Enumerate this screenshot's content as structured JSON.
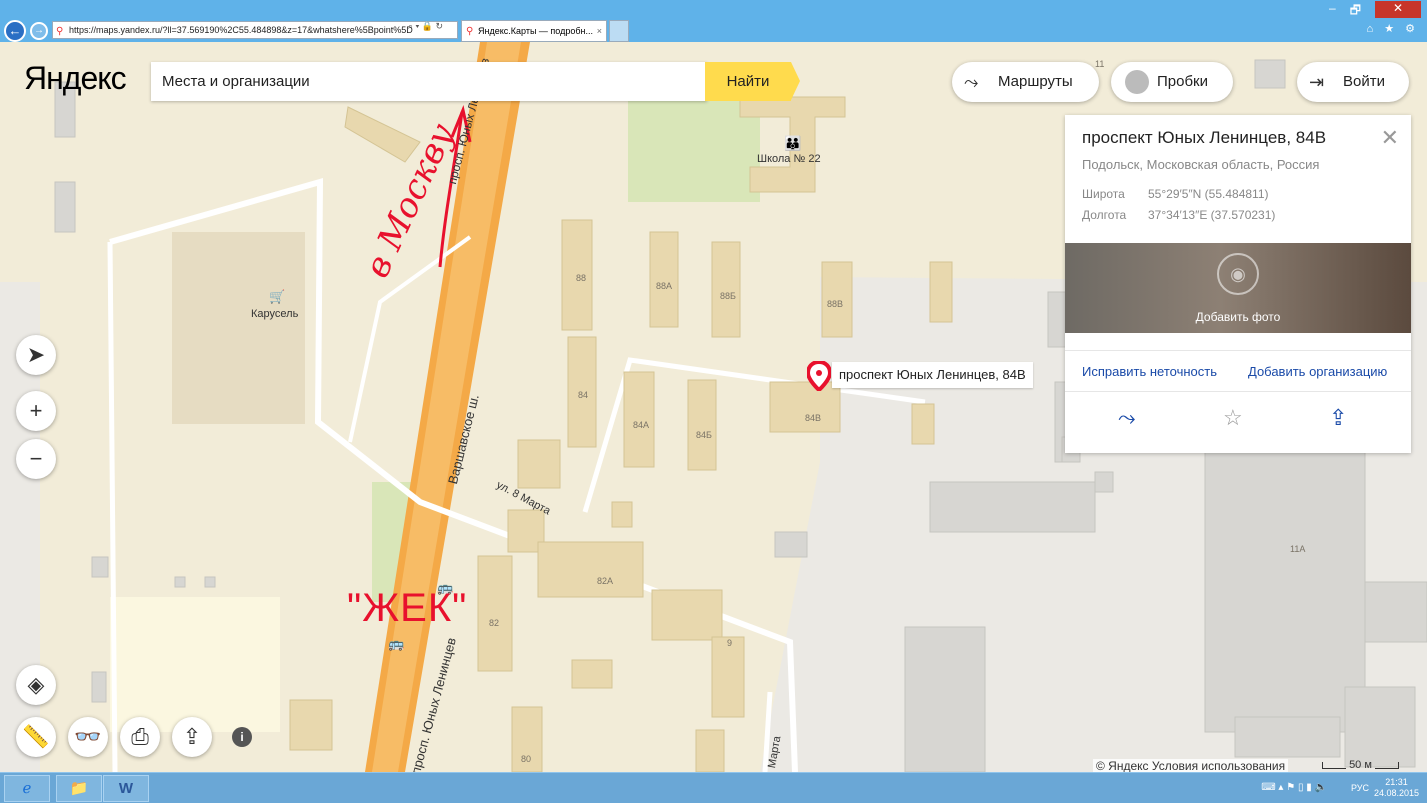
{
  "browser": {
    "url": "https://maps.yandex.ru/?ll=37.569190%2C55.484898&z=17&whatshere%5Bpoint%5D",
    "tab_title": "Яндекс.Карты — подробн...",
    "tab_close": "×",
    "back_icon": "arrow-left-icon",
    "forward_icon": "arrow-right-icon",
    "window_buttons": [
      "–",
      "🗗",
      "✕"
    ],
    "right_icons": "⌂ ★ ⚙"
  },
  "header": {
    "logo": "Яндекс",
    "search_placeholder": "Места и организации",
    "search_button": "Найти",
    "routes_label": "Маршруты",
    "traffic_label": "Пробки",
    "login_label": "Войти"
  },
  "card": {
    "title": "проспект Юных Ленинцев, 84В",
    "subtitle": "Подольск, Московская область, Россия",
    "lat_label": "Широта",
    "lat_value": "55°29′5″N (55.484811)",
    "lon_label": "Долгота",
    "lon_value": "37°34′13″E (37.570231)",
    "add_photo": "Добавить фото",
    "fix_link": "Исправить неточность",
    "add_org_link": "Добавить организацию",
    "close": "✕"
  },
  "map": {
    "marker_label": "проспект Юных Ленинцев, 84В",
    "poi_school": "Школа № 22",
    "poi_karusel": "Карусель",
    "street_main": "просп. Юных Ленинцев",
    "street_main_lower": "просп. Юных Ленинцев",
    "street_varsh": "Варшавское ш.",
    "street_8marta": "ул. 8 Марта",
    "street_marta": "Марта",
    "buildings": {
      "b88": "88",
      "b88a": "88А",
      "b88b": "88Б",
      "b88v": "88В",
      "b84": "84",
      "b84a": "84А",
      "b84b": "84Б",
      "b84v": "84В",
      "b82": "82",
      "b82a": "82А",
      "b9": "9",
      "b80": "80",
      "b11": "11",
      "b11a": "11А"
    },
    "handwriting": "в Москву",
    "annotation": "\"ЖЕК\"",
    "copyright": "© Яндекс",
    "terms": "Условия использования",
    "scale": "50 м"
  },
  "taskbar": {
    "lang": "РУС",
    "time": "21:31",
    "date": "24.08.2015"
  }
}
